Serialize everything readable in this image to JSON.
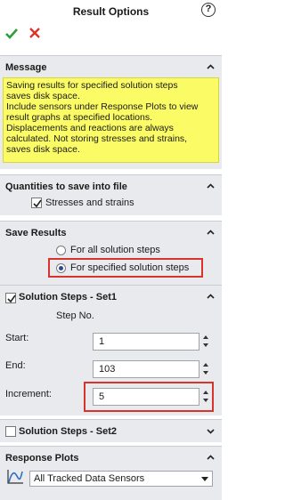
{
  "header": {
    "title": "Result Options",
    "help": "?"
  },
  "message": {
    "heading": "Message",
    "text": "Saving results for specified solution steps\nsaves disk space.\nInclude sensors under Response Plots to view\nresult graphs at specified locations.\nDisplacements and reactions are always\ncalculated. Not storing stresses and strains,\nsaves disk space."
  },
  "quantities": {
    "heading": "Quantities to save into file",
    "stresses_label": "Stresses and strains",
    "stresses_checked": true
  },
  "save_results": {
    "heading": "Save Results",
    "options": [
      "For all solution steps",
      "For specified solution steps"
    ],
    "selected": "For specified solution steps"
  },
  "set1": {
    "heading": "Solution Steps - Set1",
    "checked": true,
    "step_no_label": "Step No.",
    "start_label": "Start:",
    "start_value": "1",
    "end_label": "End:",
    "end_value": "103",
    "increment_label": "Increment:",
    "increment_value": "5"
  },
  "set2": {
    "heading": "Solution Steps - Set2",
    "checked": false
  },
  "response_plots": {
    "heading": "Response Plots",
    "selected": "All Tracked Data Sensors",
    "icon": "graph-icon"
  },
  "colors": {
    "ok_green": "#2e9e3a",
    "cancel_red": "#d9342b",
    "highlight_red": "#d9342b",
    "message_yellow": "#fbfb66",
    "panel_bg": "#e9eaee"
  }
}
